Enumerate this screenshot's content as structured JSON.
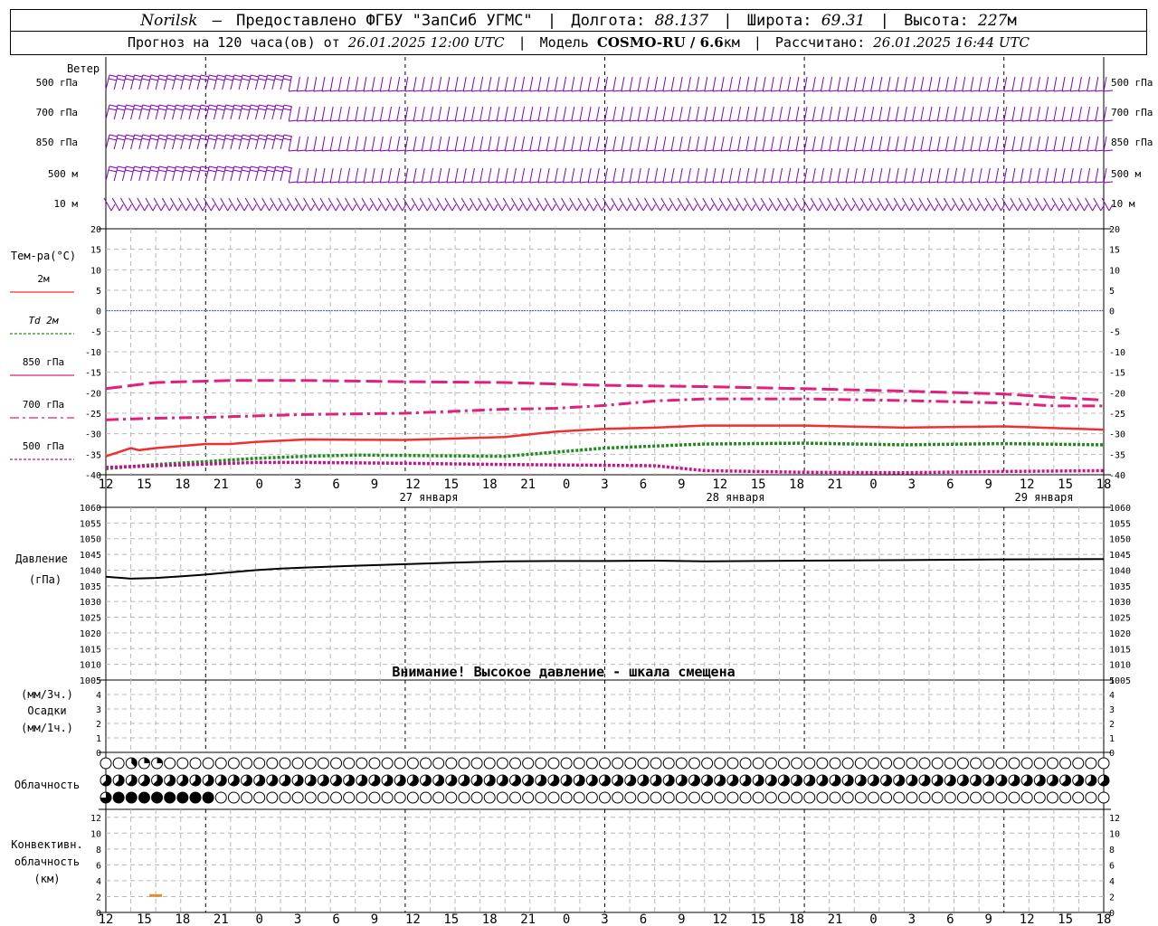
{
  "header": {
    "city": "Norilsk",
    "provider": "Предоставлено ФГБУ \"ЗапСиб УГМС\"",
    "lon_label": "Долгота:",
    "lon": "88.137",
    "lat_label": "Широта:",
    "lat": "69.31",
    "alt_label": "Высота:",
    "alt": "227",
    "alt_unit": "м",
    "forecast_prefix": "Прогноз на 120 часа(ов) от",
    "forecast_start": "26.01.2025 12:00 UTC",
    "model_label": "Модель",
    "model": "COSMO-RU / 6.6",
    "model_unit": "км",
    "computed_label": "Рассчитано:",
    "computed": "26.01.2025 16:44 UTC"
  },
  "colors": {
    "wind": "#8000c0",
    "t2m": "#f03030",
    "td2m": "#1e8c1e",
    "t850": "#e0207a",
    "t700": "#e0207a",
    "t500": "#d01088",
    "pressure": "#000000",
    "conv": "#e09030",
    "zero_line": "#3355ff"
  },
  "chart_data": [
    {
      "type": "wind-barbs",
      "title": "Ветер",
      "levels": [
        "500 гПа",
        "700 гПа",
        "850 гПа",
        "500 м",
        "10 м"
      ],
      "note": "purple wind barbs, one per hour per level"
    },
    {
      "type": "line",
      "ylabel": "Тем-ра(°C)",
      "ylim": [
        -40,
        20
      ],
      "yticks": [
        20,
        15,
        10,
        5,
        0,
        -5,
        -10,
        -15,
        -20,
        -25,
        -30,
        -35,
        -40
      ],
      "xlabel_hours": [
        "12",
        "15",
        "18",
        "21",
        "0",
        "3",
        "6",
        "9",
        "12",
        "15",
        "18",
        "21",
        "0",
        "3",
        "6",
        "9",
        "12",
        "15",
        "18",
        "21",
        "0",
        "3",
        "6",
        "9",
        "12",
        "15",
        "18"
      ],
      "date_labels": [
        "27 января",
        "28 января",
        "29 января"
      ],
      "legend": [
        "2м",
        "Td 2м",
        "850 гПа",
        "700 гПа",
        "500 гПа"
      ],
      "series": [
        {
          "name": "850 гПа",
          "style": "long-dash",
          "x": [
            0,
            6,
            15,
            24,
            36,
            48,
            60,
            72,
            84,
            96,
            108,
            114,
            120
          ],
          "y": [
            -19,
            -17.5,
            -17,
            -17,
            -17.3,
            -17.5,
            -18.2,
            -18.5,
            -19,
            -19.6,
            -20.3,
            -21.1,
            -21.8
          ]
        },
        {
          "name": "700 гПа",
          "style": "dash-dot",
          "x": [
            0,
            6,
            12,
            24,
            36,
            48,
            54,
            60,
            66,
            72,
            84,
            96,
            108,
            114,
            120
          ],
          "y": [
            -26.6,
            -26.2,
            -26,
            -25.3,
            -25,
            -24,
            -23.8,
            -23.1,
            -22,
            -21.5,
            -21.5,
            -21.9,
            -22.5,
            -23.2,
            -23.2
          ]
        },
        {
          "name": "2м",
          "style": "solid",
          "x": [
            0,
            3,
            4,
            6,
            9,
            12,
            15,
            18,
            24,
            36,
            48,
            54,
            60,
            66,
            72,
            84,
            96,
            108,
            120
          ],
          "y": [
            -35.5,
            -33.5,
            -34,
            -33.5,
            -33,
            -32.5,
            -32.5,
            -32,
            -31.4,
            -31.5,
            -30.8,
            -29.5,
            -28.8,
            -28.5,
            -28,
            -28,
            -28.5,
            -28.2,
            -29
          ]
        },
        {
          "name": "Td 2м",
          "style": "dotted",
          "x": [
            0,
            6,
            12,
            18,
            24,
            30,
            36,
            48,
            60,
            72,
            84,
            96,
            108,
            120
          ],
          "y": [
            -38.5,
            -37.5,
            -36.8,
            -36,
            -35.5,
            -35.2,
            -35.3,
            -35.5,
            -33.5,
            -32.5,
            -32.3,
            -32.7,
            -32.4,
            -32.7
          ]
        },
        {
          "name": "500 гПа",
          "style": "dotted",
          "x": [
            0,
            6,
            12,
            18,
            24,
            36,
            48,
            60,
            66,
            72,
            84,
            96,
            108,
            120
          ],
          "y": [
            -38.2,
            -37.8,
            -37.4,
            -37,
            -37,
            -37.2,
            -37.5,
            -37.7,
            -37.8,
            -39,
            -39.4,
            -39.5,
            -39.2,
            -39
          ]
        }
      ]
    },
    {
      "type": "line",
      "ylabel": "Давление",
      "yunit": "(гПа)",
      "ylim": [
        1005,
        1060
      ],
      "yticks": [
        1060,
        1055,
        1050,
        1045,
        1040,
        1035,
        1030,
        1025,
        1020,
        1015,
        1010,
        1005
      ],
      "warning": "Внимание! Высокое давление - шкала смещена",
      "series": [
        {
          "name": "Давление",
          "x": [
            0,
            3,
            6,
            9,
            12,
            15,
            18,
            21,
            24,
            30,
            36,
            42,
            48,
            54,
            60,
            66,
            72,
            84,
            96,
            108,
            120
          ],
          "y": [
            1037.9,
            1037.3,
            1037.5,
            1038,
            1038.6,
            1039.3,
            1040,
            1040.5,
            1040.8,
            1041.4,
            1041.9,
            1042.4,
            1042.8,
            1042.9,
            1042.9,
            1043,
            1042.8,
            1043,
            1043.2,
            1043.4,
            1043.5
          ]
        }
      ]
    },
    {
      "type": "bar",
      "ylabel_top": "(мм/3ч.)",
      "ylabel": "Осадки",
      "ylabel_bottom": "(мм/1ч.)",
      "ylim": [
        0,
        5
      ],
      "yticks": [
        5,
        4,
        3,
        2,
        1,
        0
      ],
      "values": []
    },
    {
      "type": "table",
      "title": "Облачность",
      "note": "cloud fraction per hour in eighths (0=clear, 8=overcast) for high/mid/low rows",
      "rows": {
        "high": [
          0,
          0,
          0,
          3,
          2,
          2,
          2,
          2,
          0,
          0,
          0,
          0,
          0,
          0,
          0,
          0,
          0,
          0,
          0,
          0,
          0,
          0,
          0,
          0,
          0,
          0,
          0,
          0,
          0,
          0,
          0,
          0,
          0,
          0,
          0,
          0,
          0,
          0,
          0,
          0,
          0,
          0,
          0,
          0,
          0,
          0,
          0,
          0,
          0,
          0,
          0,
          0,
          0,
          0,
          0,
          0,
          0,
          0,
          0,
          0,
          0,
          0,
          0,
          0,
          0,
          0,
          0,
          0,
          0,
          0,
          0,
          0,
          0,
          0,
          0,
          0,
          0,
          0,
          0,
          0,
          0,
          0,
          0,
          0,
          0,
          0,
          0,
          0,
          0,
          0,
          0,
          0,
          0,
          0,
          0,
          0,
          0,
          0,
          0,
          0,
          0,
          0,
          0,
          0,
          0,
          0,
          0,
          0,
          0,
          0,
          0,
          0,
          0,
          0,
          0,
          0,
          0,
          0,
          0,
          0,
          0
        ],
        "mid": [
          5,
          5,
          5,
          5,
          5,
          5,
          5,
          5,
          5,
          5,
          5,
          5,
          5,
          5,
          5,
          5,
          5,
          5,
          5,
          5,
          5,
          5,
          5,
          5,
          5,
          5,
          5,
          5,
          5,
          5,
          5,
          5,
          5,
          5,
          5,
          5,
          5,
          5,
          5,
          5,
          5,
          5,
          5,
          5,
          5,
          5,
          5,
          5,
          5,
          5,
          5,
          5,
          5,
          5,
          5,
          5,
          5,
          5,
          5,
          5,
          5,
          5,
          5,
          5,
          5,
          5,
          5,
          5,
          5,
          5,
          5,
          5,
          5,
          5,
          5,
          5,
          5,
          5,
          5,
          5,
          5,
          5,
          5,
          5,
          5,
          5,
          5,
          5,
          5,
          5,
          5,
          5,
          5,
          5,
          5,
          5,
          5,
          5,
          5,
          5,
          5,
          5,
          5,
          5,
          5,
          5,
          5,
          5,
          5,
          5,
          5,
          5,
          5,
          5,
          5,
          5,
          5,
          5,
          5,
          5,
          5
        ],
        "low": [
          6,
          5,
          8,
          8,
          8,
          8,
          8,
          8,
          8,
          8,
          8,
          8,
          8,
          8,
          0,
          0,
          0,
          0,
          0,
          0,
          0,
          0,
          0,
          0,
          0,
          0,
          0,
          0,
          0,
          0,
          0,
          0,
          0,
          0,
          0,
          0,
          0,
          0,
          0,
          0,
          0,
          0,
          0,
          0,
          0,
          0,
          0,
          0,
          0,
          0,
          0,
          0,
          0,
          0,
          0,
          0,
          0,
          0,
          0,
          0,
          0,
          0,
          0,
          0,
          0,
          0,
          0,
          0,
          0,
          0,
          0,
          0,
          0,
          0,
          0,
          0,
          0,
          0,
          0,
          0,
          0,
          0,
          0,
          0,
          0,
          0,
          0,
          0,
          0,
          0,
          0,
          0,
          0,
          0,
          0,
          0,
          0,
          0,
          0,
          0,
          0,
          0,
          0,
          0,
          0,
          0,
          0,
          0,
          0,
          0,
          0,
          0,
          0,
          0,
          0,
          0,
          0,
          0,
          0,
          0,
          0
        ]
      }
    },
    {
      "type": "bar",
      "ylabel": [
        "Конвективн.",
        "облачность",
        "(км)"
      ],
      "ylim": [
        0,
        13
      ],
      "yticks": [
        12,
        10,
        8,
        6,
        4,
        2,
        0
      ],
      "bars": [
        {
          "x": 6,
          "bottom": 2,
          "top": 2.3
        }
      ]
    }
  ]
}
